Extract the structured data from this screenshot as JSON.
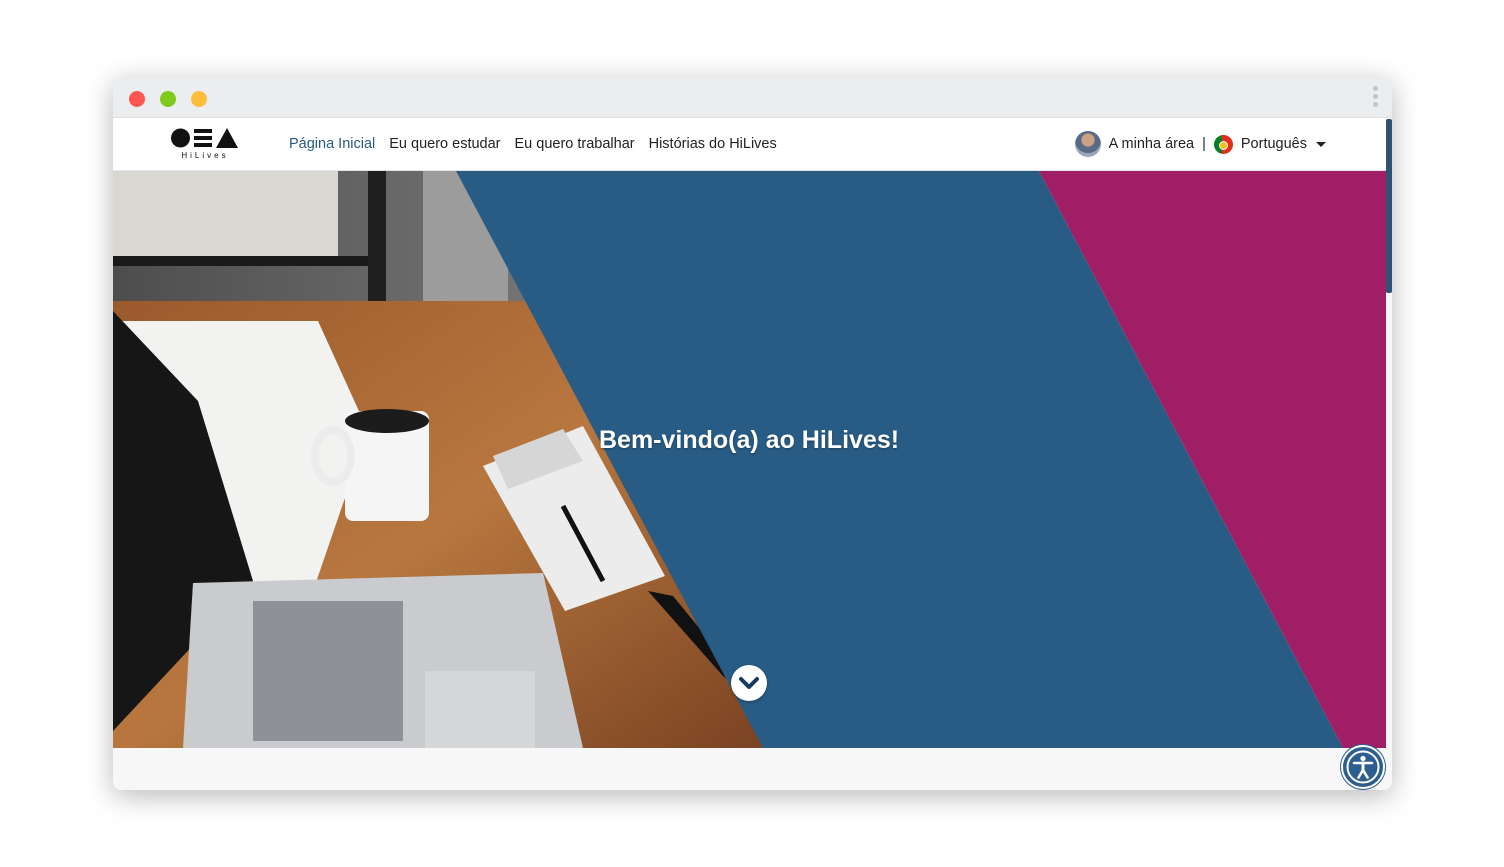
{
  "window": {
    "controls": [
      "close",
      "minimize",
      "maximize"
    ],
    "menu_icon": "kebab-menu-icon"
  },
  "brand": {
    "name": "HiLives"
  },
  "nav": {
    "links": [
      {
        "label": "Página Inicial",
        "active": true
      },
      {
        "label": "Eu quero estudar",
        "active": false
      },
      {
        "label": "Eu quero trabalhar",
        "active": false
      },
      {
        "label": "Histórias do HiLives",
        "active": false
      }
    ],
    "user_area": "A minha área",
    "separator": "|",
    "language": "Português"
  },
  "hero": {
    "title": "Bem-vindo(a) ao HiLives!",
    "scroll_icon": "chevron-down-icon"
  },
  "accessibility": {
    "icon": "accessibility-icon"
  },
  "colors": {
    "blue": "#285c85",
    "magenta": "#a01e65",
    "active_link": "#295a83",
    "accessibility": "#2c5f8f"
  }
}
